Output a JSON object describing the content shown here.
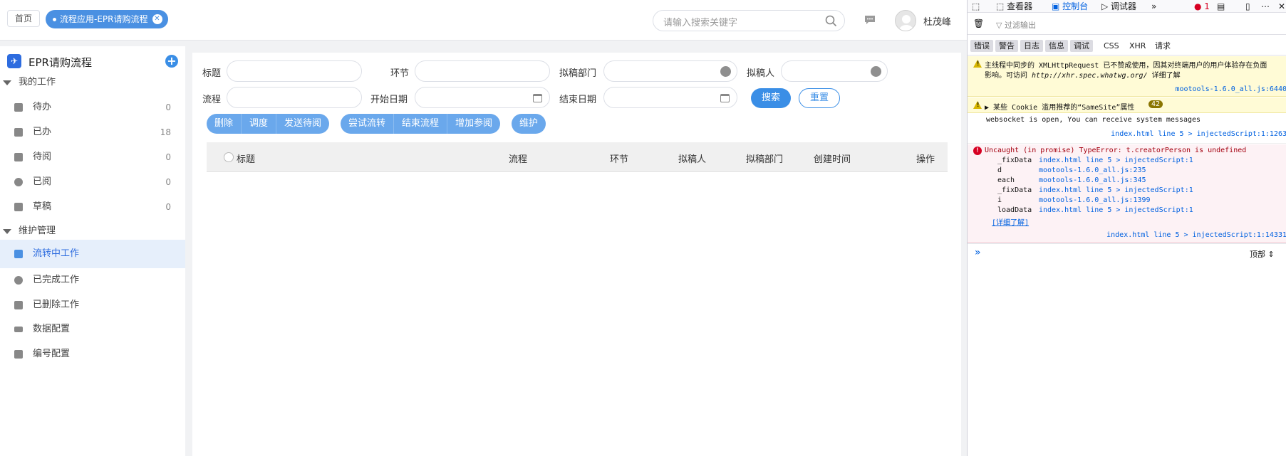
{
  "topbar": {
    "home_tab": "首页",
    "active_tab": "流程应用-EPR请购流程",
    "search_placeholder": "请输入搜索关键字",
    "username": "杜茂峰"
  },
  "sidebar": {
    "title": "EPR请购流程",
    "group1": "我的工作",
    "items1": [
      {
        "label": "待办",
        "count": "0"
      },
      {
        "label": "已办",
        "count": "18"
      },
      {
        "label": "待阅",
        "count": "0"
      },
      {
        "label": "已阅",
        "count": "0"
      },
      {
        "label": "草稿",
        "count": "0"
      }
    ],
    "group2": "维护管理",
    "items2": [
      {
        "label": "流转中工作"
      },
      {
        "label": "已完成工作"
      },
      {
        "label": "已删除工作"
      },
      {
        "label": "数据配置"
      },
      {
        "label": "编号配置"
      }
    ]
  },
  "form": {
    "title_label": "标题",
    "step_label": "环节",
    "dept_label": "拟稿部门",
    "drafter_label": "拟稿人",
    "flow_label": "流程",
    "start_label": "开始日期",
    "end_label": "结束日期",
    "search_btn": "搜索",
    "reset_btn": "重置"
  },
  "actions": {
    "group1": [
      "删除",
      "调度",
      "发送待阅"
    ],
    "group2": [
      "尝试流转",
      "结束流程",
      "增加参阅"
    ],
    "maintain": "维护"
  },
  "table": {
    "columns": [
      "标题",
      "流程",
      "环节",
      "拟稿人",
      "拟稿部门",
      "创建时间",
      "操作"
    ]
  },
  "devtools": {
    "tabs": [
      "查看器",
      "控制台",
      "调试器"
    ],
    "error_count": "1",
    "filter_placeholder": "过滤输出",
    "categories": [
      "错误",
      "警告",
      "日志",
      "信息",
      "调试",
      "CSS",
      "XHR",
      "请求"
    ],
    "warn1_line1": "主线程中同步的 XMLHttpRequest 已不赞成使用，因其对终端用户的用户体验存在负面",
    "warn1_line2a": "影响。可访问",
    "warn1_link": "http://xhr.spec.whatwg.org/",
    "warn1_line2b": "详细了解",
    "warn1_src": "mootools-1.6.0_all.js:6440",
    "warn2": "▶ 某些 Cookie 滥用推荐的“SameSite”属性",
    "warn2_badge": "42",
    "log1": "websocket is open, You can receive system messages",
    "log1_src": "index.html line 5 > injectedScript:1:1263",
    "err_msg": "Uncaught (in promise) TypeError: t.creatorPerson is undefined",
    "stack": [
      {
        "fn": "_fixData",
        "src": "index.html line 5 > injectedScript:1"
      },
      {
        "fn": "d",
        "src": "mootools-1.6.0_all.js:235"
      },
      {
        "fn": "each",
        "src": "mootools-1.6.0_all.js:345"
      },
      {
        "fn": "_fixData",
        "src": "index.html line 5 > injectedScript:1"
      },
      {
        "fn": "i",
        "src": "mootools-1.6.0_all.js:1399"
      },
      {
        "fn": "loadData",
        "src": "index.html line 5 > injectedScript:1"
      }
    ],
    "learn_more": "[详细了解]",
    "err_src": "index.html line 5 > injectedScript:1:14331",
    "context": "顶部 ⇕"
  }
}
